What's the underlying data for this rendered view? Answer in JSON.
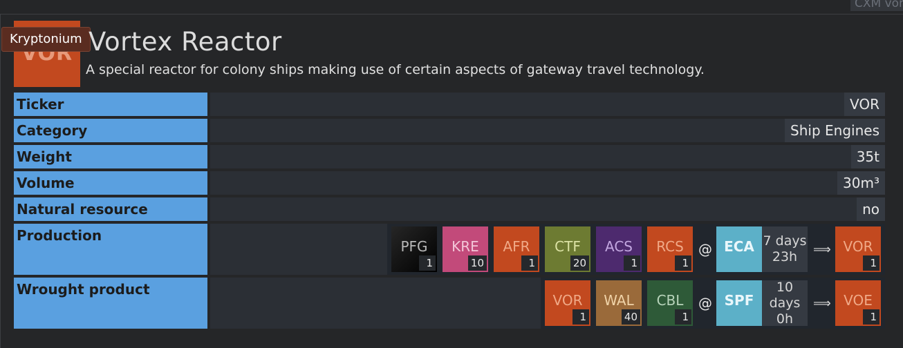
{
  "corner_tag": "CXM vor",
  "material": {
    "ticker": "VOR",
    "tooltip": "Kryptonium",
    "title": "Vortex Reactor",
    "description": "A special reactor for colony ships making use of certain aspects of gateway travel technology."
  },
  "rows": {
    "ticker": {
      "label": "Ticker",
      "value": "VOR"
    },
    "category": {
      "label": "Category",
      "value": "Ship Engines"
    },
    "weight": {
      "label": "Weight",
      "value": "35t"
    },
    "volume": {
      "label": "Volume",
      "value": "30m³"
    },
    "natural": {
      "label": "Natural resource",
      "value": "no"
    },
    "production": {
      "label": "Production",
      "inputs": [
        {
          "ticker": "PFG",
          "qty": "1",
          "color": "#141414"
        },
        {
          "ticker": "KRE",
          "qty": "10",
          "color": "#c24a7a"
        },
        {
          "ticker": "AFR",
          "qty": "1",
          "color": "#c2491f"
        },
        {
          "ticker": "CTF",
          "qty": "20",
          "color": "#6d7b32"
        },
        {
          "ticker": "ACS",
          "qty": "1",
          "color": "#4d2a6e"
        },
        {
          "ticker": "RCS",
          "qty": "1",
          "color": "#c2491f"
        }
      ],
      "at": "@",
      "building": "ECA",
      "duration_line1": "7 days",
      "duration_line2": "23h",
      "arrow": "⟹",
      "output": {
        "ticker": "VOR",
        "qty": "1"
      }
    },
    "wrought": {
      "label": "Wrought product",
      "inputs": [
        {
          "ticker": "VOR",
          "qty": "1",
          "color": "#c2491f"
        },
        {
          "ticker": "WAL",
          "qty": "40",
          "color": "#9a6a3a"
        },
        {
          "ticker": "CBL",
          "qty": "1",
          "color": "#2e5a38"
        }
      ],
      "at": "@",
      "building": "SPF",
      "duration_line1": "10",
      "duration_line2": "days",
      "duration_line3": "0h",
      "arrow": "⟹",
      "output": {
        "ticker": "VOE",
        "qty": "1"
      }
    }
  },
  "colors": {
    "label_bg": "#5aa0e0",
    "building_bg": "#5cb0c8",
    "output_bg": "#c2491f"
  }
}
